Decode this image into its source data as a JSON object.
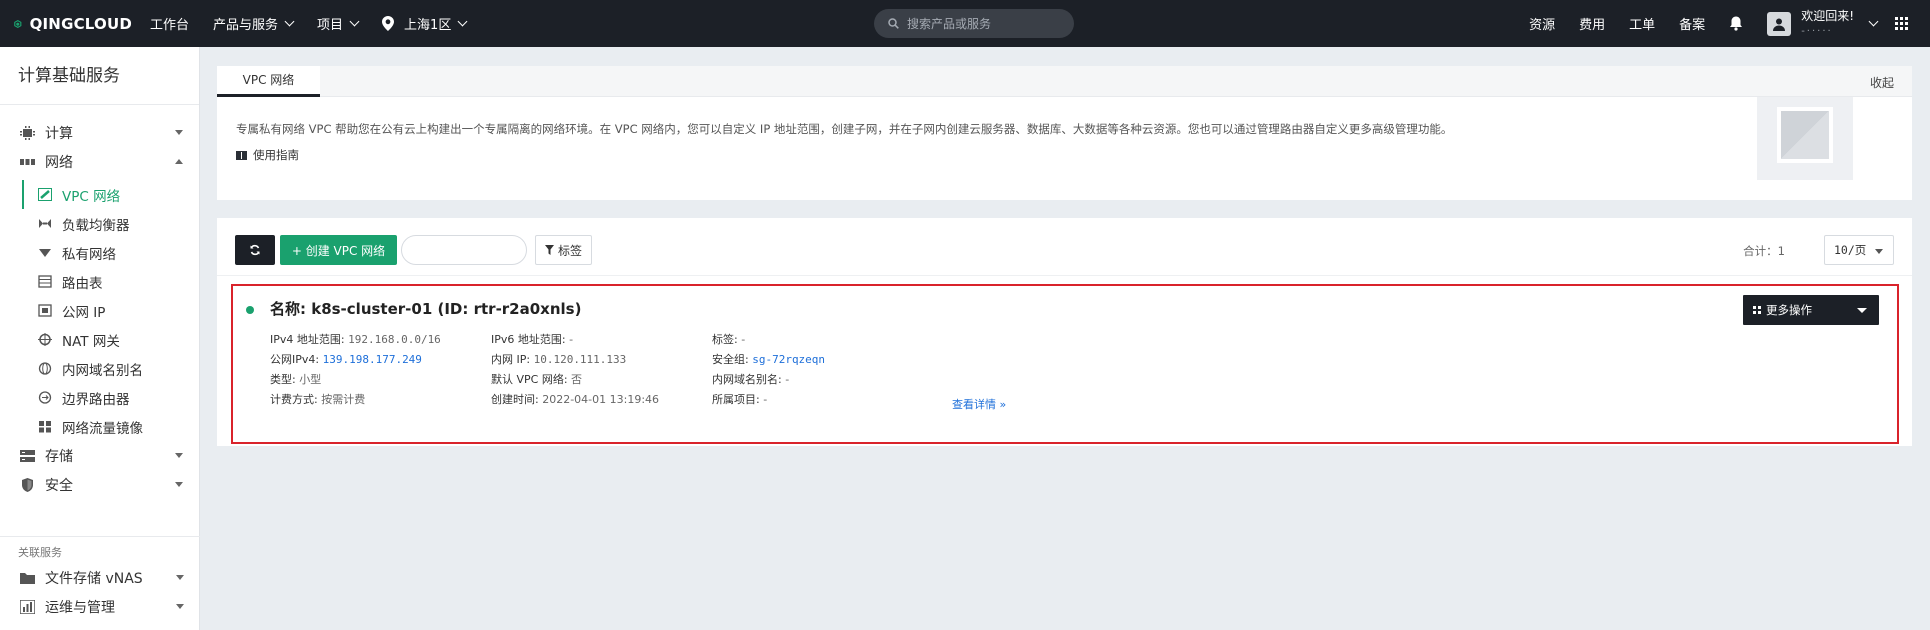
{
  "topbar": {
    "brand": "QINGCLOUD",
    "nav": [
      "工作台",
      "产品与服务",
      "项目",
      "上海1区"
    ],
    "search_placeholder": "搜索产品或服务",
    "links": [
      "资源",
      "费用",
      "工单",
      "备案"
    ],
    "user_greeting": "欢迎回来!",
    "user_sub": "-·····"
  },
  "sidebar": {
    "title": "计算基础服务",
    "groups": {
      "compute": "计算",
      "network": "网络",
      "storage": "存储",
      "security": "安全"
    },
    "network_items": [
      "VPC 网络",
      "负载均衡器",
      "私有网络",
      "路由表",
      "公网 IP",
      "NAT 网关",
      "内网域名别名",
      "边界路由器",
      "网络流量镜像"
    ],
    "section_label": "关联服务",
    "related": [
      "文件存储 vNAS",
      "运维与管理"
    ]
  },
  "intro": {
    "tab": "VPC 网络",
    "collapse": "收起",
    "description": "专属私有网络 VPC 帮助您在公有云上构建出一个专属隔离的网络环境。在 VPC 网络内，您可以自定义 IP 地址范围，创建子网，并在子网内创建云服务器、数据库、大数据等各种云资源。您也可以通过管理路由器自定义更多高级管理功能。",
    "guide": "使用指南"
  },
  "list": {
    "create_label": "+ 创建 VPC 网络",
    "search_value": "",
    "tag_label": "标签",
    "total": "合计：1",
    "page_size": "10/页"
  },
  "vpc": {
    "name": "名称: k8s-cluster-01 (ID: rtr-r2a0xnls)",
    "more_actions": "更多操作",
    "col1": [
      {
        "label": "IPv4 地址范围: ",
        "value": "192.168.0.0/16"
      },
      {
        "label": "公网IPv4: ",
        "value": "139.198.177.249"
      },
      {
        "label": "类型: ",
        "value": "小型"
      },
      {
        "label": "计费方式: ",
        "value": "按需计费"
      }
    ],
    "col2": [
      {
        "label": "IPv6 地址范围: ",
        "value": "-"
      },
      {
        "label": "内网 IP: ",
        "value": "10.120.111.133"
      },
      {
        "label": "默认 VPC 网络: ",
        "value": "否"
      },
      {
        "label": "创建时间: ",
        "value": "2022-04-01 13:19:46"
      }
    ],
    "col3": [
      {
        "label": "标签: ",
        "value": "-"
      },
      {
        "label": "安全组: ",
        "value": "sg-72rqzeqn"
      },
      {
        "label": "内网域名别名: ",
        "value": "-"
      },
      {
        "label": "所属项目: ",
        "value": "-"
      }
    ],
    "detail_link": "查看详情 »"
  },
  "colors": {
    "topbar_bg": "#1c2027",
    "brand_green": "#1aa16e",
    "highlight_red": "#d9232b",
    "link_blue": "#1e6fd9"
  }
}
